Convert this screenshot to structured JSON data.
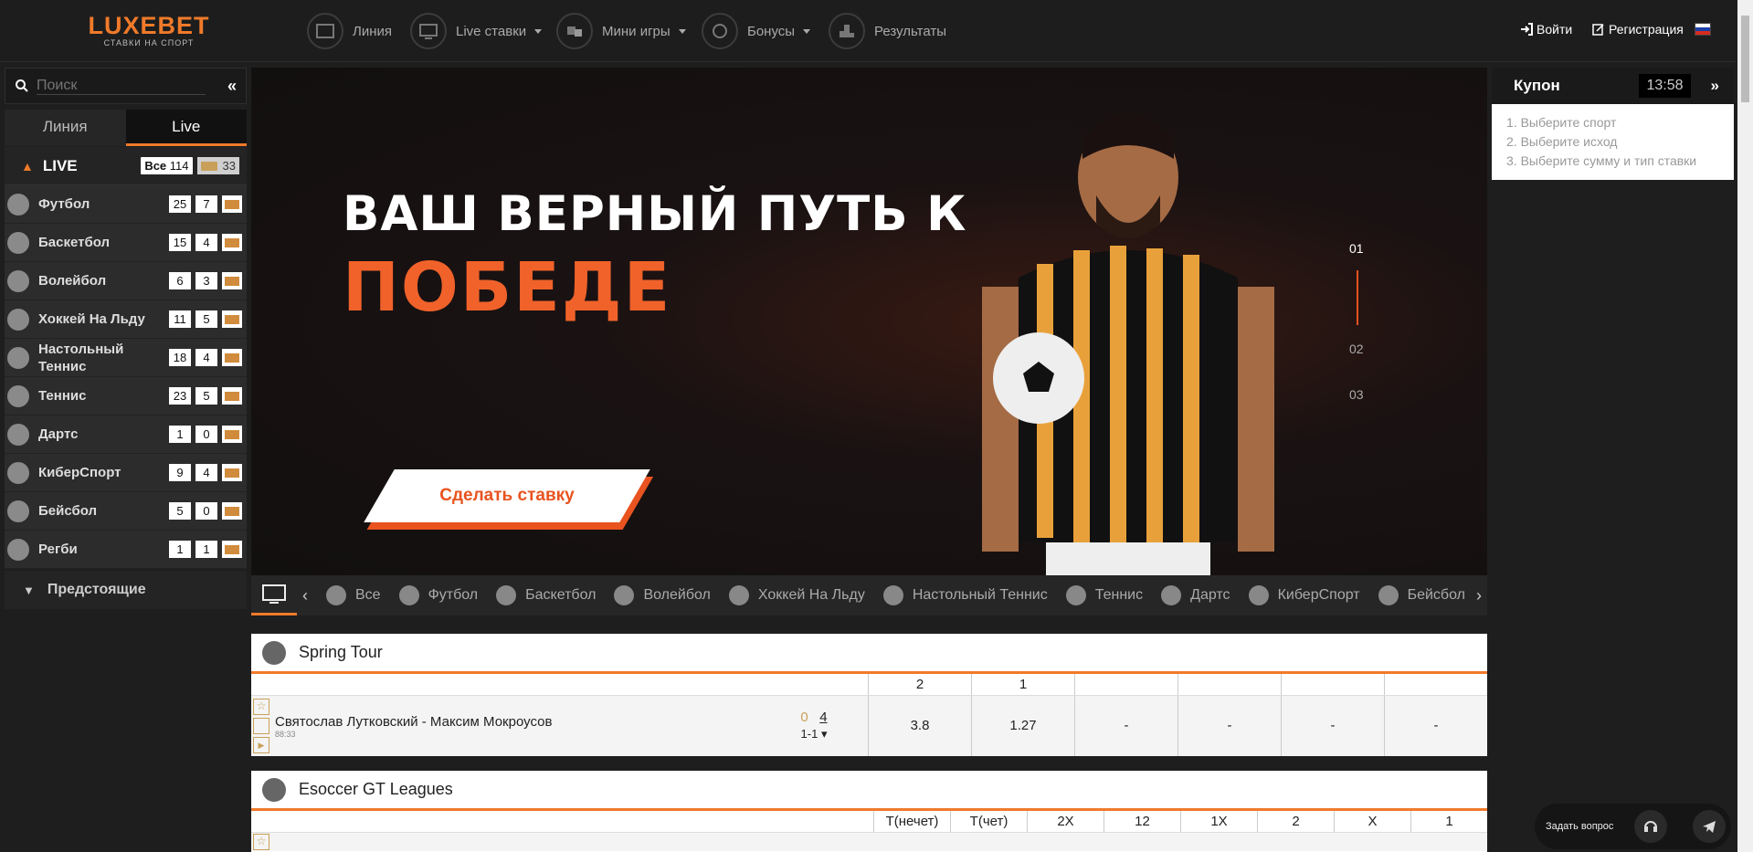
{
  "header": {
    "logo": "LUXEBET",
    "logo_sub": "СТАВКИ НА СПОРТ",
    "nav": [
      {
        "label": "Линия",
        "icon": "line-icon"
      },
      {
        "label": "Live ставки",
        "icon": "live-icon",
        "dropdown": true
      },
      {
        "label": "Мини игры",
        "icon": "dice-icon",
        "dropdown": true
      },
      {
        "label": "Бонусы",
        "icon": "bonus-icon",
        "dropdown": true
      },
      {
        "label": "Результаты",
        "icon": "podium-icon"
      }
    ],
    "login": "Войти",
    "register": "Регистрация",
    "language": "ru"
  },
  "sidebar": {
    "search_placeholder": "Поиск",
    "tabs": [
      "Линия",
      "Live"
    ],
    "live_title": "LIVE",
    "all_label": "Все",
    "all_count": "114",
    "live_count": "33",
    "sports": [
      {
        "name": "Футбол",
        "count": "25",
        "live": "7"
      },
      {
        "name": "Баскетбол",
        "count": "15",
        "live": "4"
      },
      {
        "name": "Волейбол",
        "count": "6",
        "live": "3"
      },
      {
        "name": "Хоккей На Льду",
        "count": "11",
        "live": "5"
      },
      {
        "name": "Настольный Теннис",
        "count": "18",
        "live": "4"
      },
      {
        "name": "Теннис",
        "count": "23",
        "live": "5"
      },
      {
        "name": "Дартс",
        "count": "1",
        "live": "0"
      },
      {
        "name": "КиберСпорт",
        "count": "9",
        "live": "4"
      },
      {
        "name": "Бейсбол",
        "count": "5",
        "live": "0"
      },
      {
        "name": "Регби",
        "count": "1",
        "live": "1"
      }
    ],
    "upcoming": "Предстоящие"
  },
  "banner": {
    "line1": "ВАШ ВЕРНЫЙ ПУТЬ К",
    "line2": "ПОБЕДЕ",
    "cta": "Сделать ставку",
    "slides": [
      "01",
      "02",
      "03"
    ],
    "active_slide": "01"
  },
  "sport_tabs": [
    "Все",
    "Футбол",
    "Баскетбол",
    "Волейбол",
    "Хоккей На Льду",
    "Настольный Теннис",
    "Теннис",
    "Дартс",
    "КиберСпорт",
    "Бейсбол"
  ],
  "events": [
    {
      "league": "Spring Tour",
      "headers": [
        "2",
        "1",
        "",
        "",
        "",
        ""
      ],
      "match": {
        "teams": "Святослав Лутковский - Максим Мокроусов",
        "time": "88:33",
        "score1": "0",
        "score2": "4",
        "sets": "1-1",
        "odds": [
          "3.8",
          "1.27",
          "-",
          "-",
          "-",
          "-"
        ]
      }
    },
    {
      "league": "Esoccer GT Leagues",
      "headers": [
        "Т(нечет)",
        "Т(чет)",
        "2Х",
        "12",
        "1Х",
        "2",
        "Х",
        "1"
      ]
    }
  ],
  "coupon": {
    "title": "Купон",
    "time": "13:58",
    "steps": [
      "1. Выберите спорт",
      "2. Выберите исход",
      "3. Выберите сумму и тип ставки"
    ]
  },
  "help": {
    "label": "Задать вопрос"
  }
}
